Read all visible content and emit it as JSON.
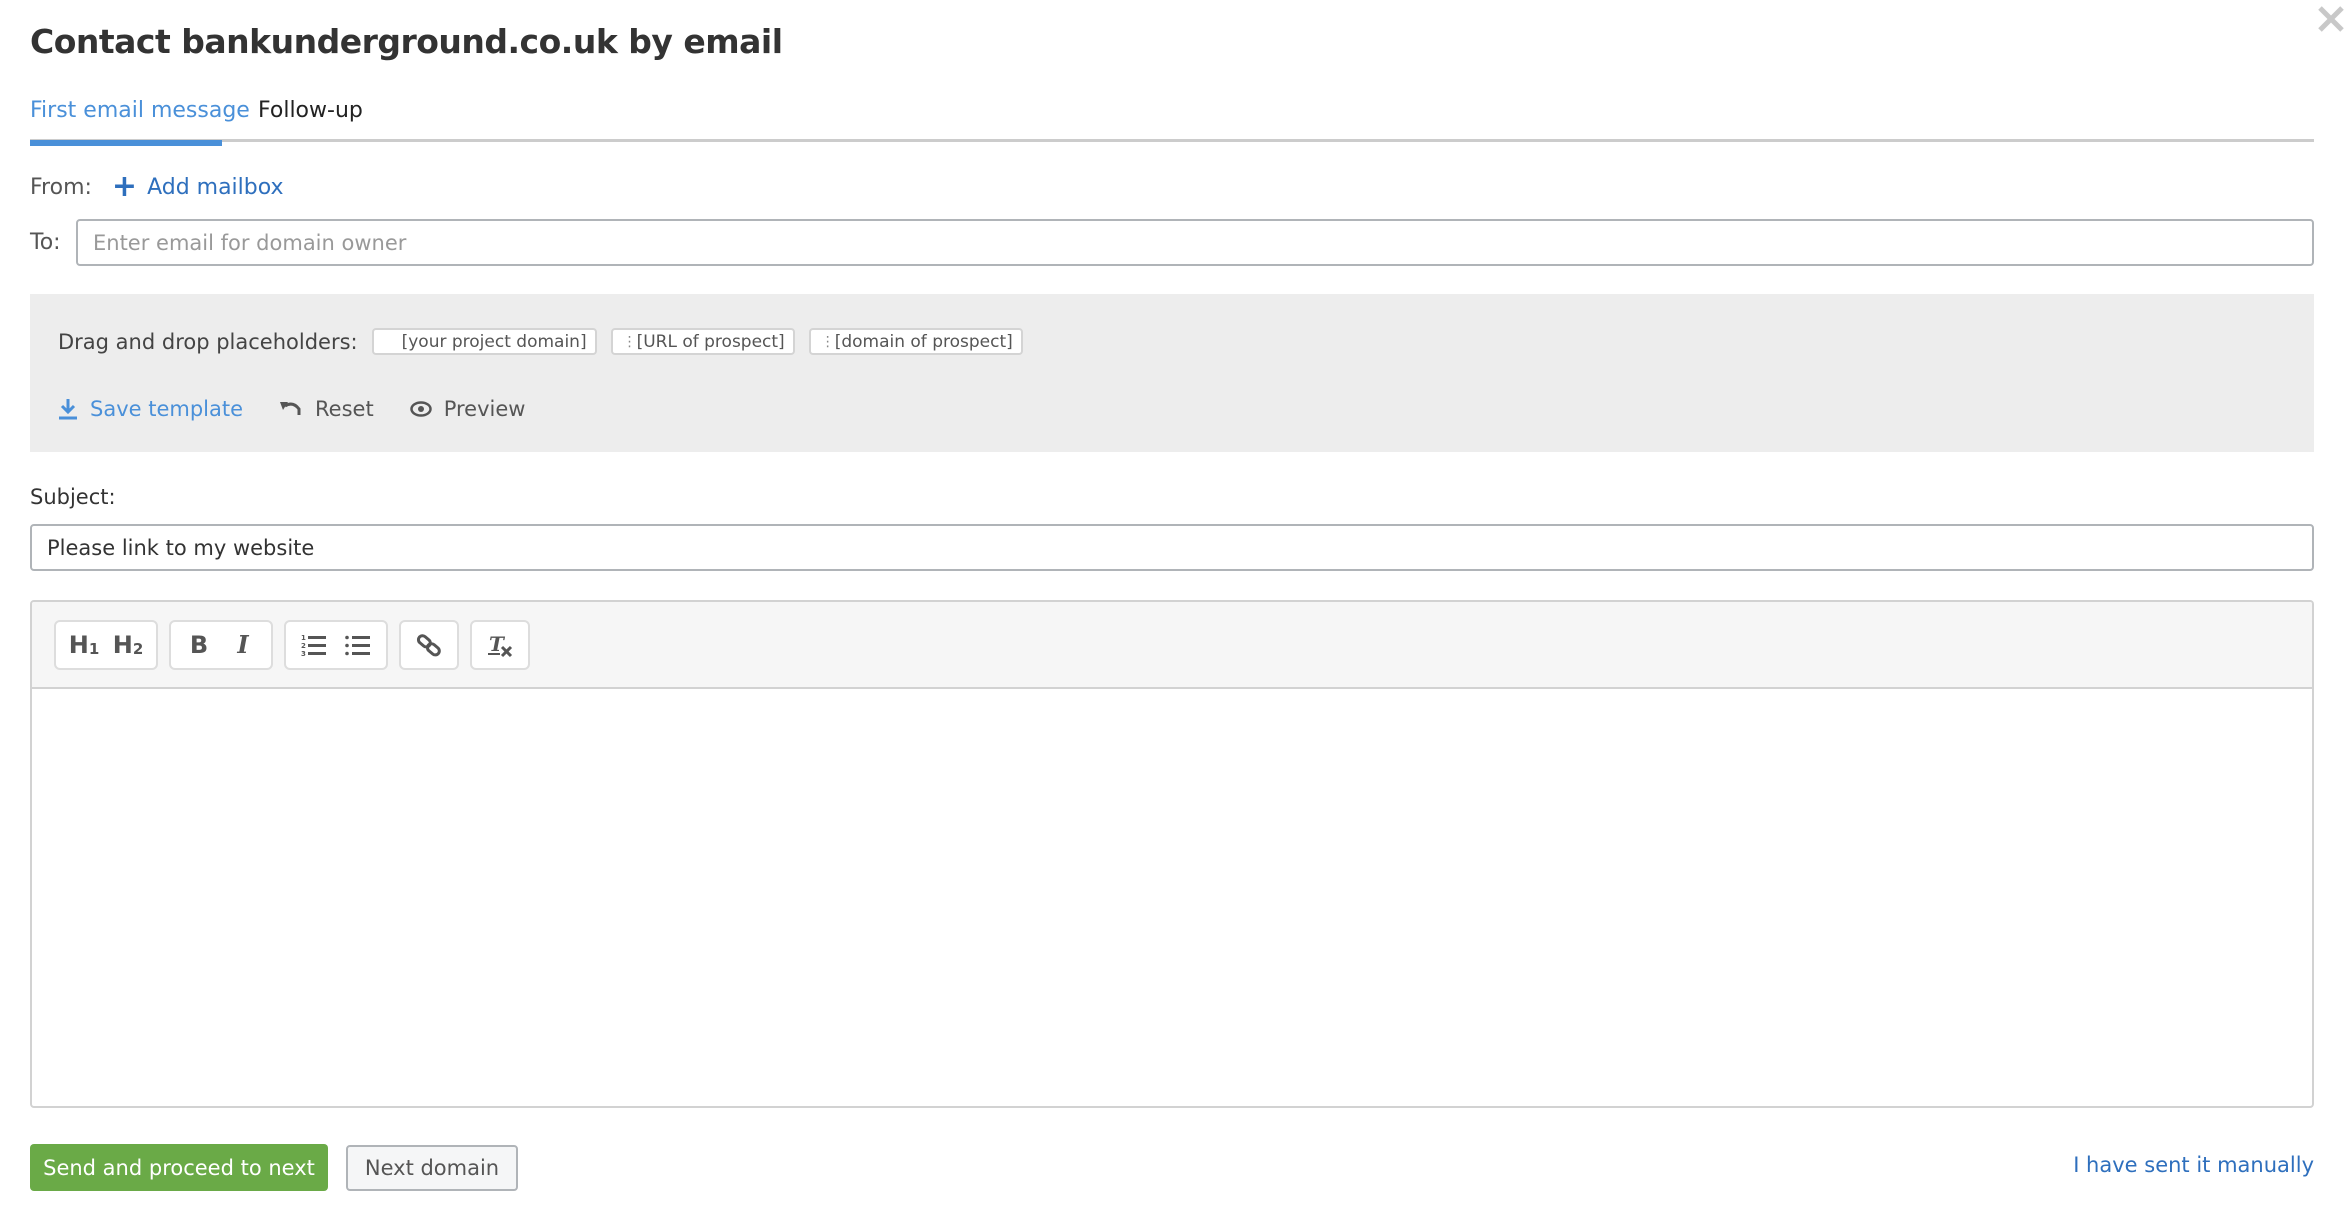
{
  "dialog": {
    "title": "Contact bankunderground.co.uk by email"
  },
  "tabs": [
    {
      "label": "First email message",
      "active": true
    },
    {
      "label": "Follow-up",
      "active": false
    }
  ],
  "from": {
    "label": "From:",
    "add_mailbox_label": "Add mailbox"
  },
  "to": {
    "label": "To:",
    "value": "",
    "placeholder": "Enter email for domain owner"
  },
  "placeholders": {
    "label": "Drag and drop placeholders:",
    "chips": [
      "[your project domain]",
      "[URL of prospect]",
      "[domain of prospect]"
    ]
  },
  "template_actions": {
    "save": "Save template",
    "reset": "Reset",
    "preview": "Preview"
  },
  "subject": {
    "label": "Subject:",
    "value": "Please link to my website"
  },
  "editor": {
    "toolbar": {
      "h1": "H",
      "h1_sub": "1",
      "h2": "H",
      "h2_sub": "2",
      "bold": "B",
      "italic": "I"
    },
    "body": ""
  },
  "footer": {
    "send_label": "Send and proceed to next",
    "next_label": "Next domain",
    "manual_label": "I have sent it manually"
  },
  "colors": {
    "accent": "#4a90d9",
    "link": "#2e6fbd",
    "primary_button": "#6aaa47"
  }
}
